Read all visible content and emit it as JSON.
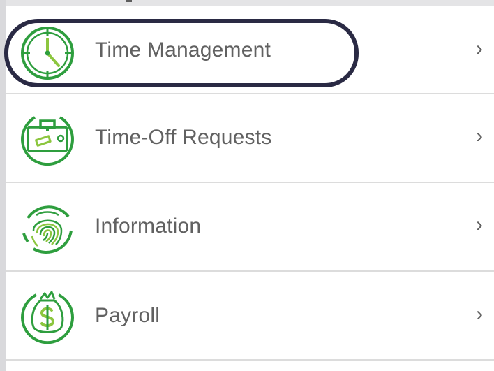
{
  "menu": {
    "items": [
      {
        "label": "Time Management",
        "icon": "clock-icon",
        "chevron": "›"
      },
      {
        "label": "Time-Off Requests",
        "icon": "briefcase-icon",
        "chevron": "›"
      },
      {
        "label": "Information",
        "icon": "fingerprint-icon",
        "chevron": "›"
      },
      {
        "label": "Payroll",
        "icon": "money-bag-icon",
        "chevron": "›"
      }
    ]
  },
  "colors": {
    "accent_green": "#2e9e3e",
    "light_green": "#8cc63f",
    "highlight_ring": "#2a2a44",
    "label_text": "#616161",
    "divider": "#dcdcdc"
  }
}
